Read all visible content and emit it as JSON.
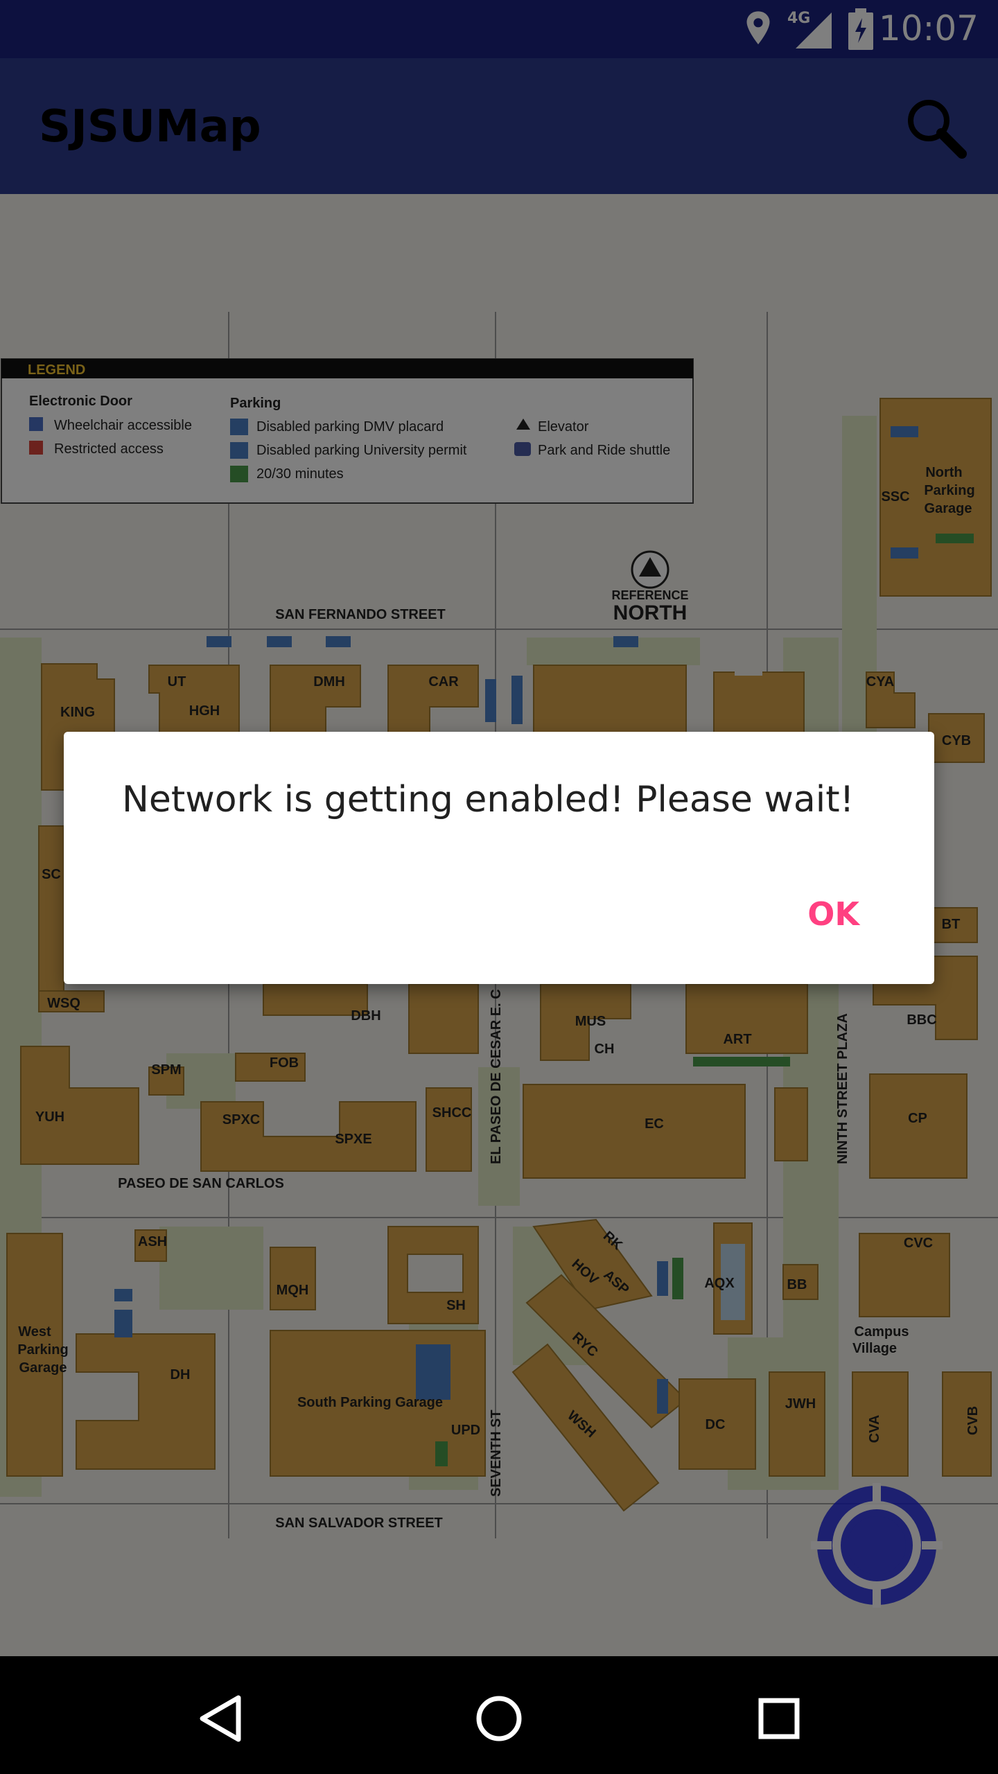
{
  "status_bar": {
    "time": "10:07",
    "network": "4G",
    "icons": [
      "location-icon",
      "signal-icon",
      "battery-icon"
    ]
  },
  "toolbar": {
    "title": "SJSUMap",
    "search_icon": "search-icon"
  },
  "map": {
    "legend": {
      "title": "LEGEND",
      "electronic_door": {
        "heading": "Electronic Door",
        "items": [
          "Wheelchair accessible",
          "Restricted access"
        ]
      },
      "parking": {
        "heading": "Parking",
        "items": [
          "Disabled parking DMV placard",
          "Disabled parking University permit",
          "20/30 minutes"
        ]
      },
      "other": [
        "Elevator",
        "Park and Ride shuttle"
      ]
    },
    "north_label": [
      "REFERENCE",
      "NORTH"
    ],
    "streets": {
      "north": "SAN FERNANDO STREET",
      "south": "SAN SALVADOR STREET",
      "mid": "PASEO DE SAN CARLOS",
      "paseo": "EL PASEO DE CESAR E. C",
      "seventh": "SEVENTH ST",
      "ninth": "NINTH STREET PLAZA"
    },
    "buildings": {
      "king": "KING",
      "ut": "UT",
      "hgh": "HGH",
      "dmh": "DMH",
      "car": "CAR",
      "ssc": "SSC",
      "npg": [
        "North",
        "Parking",
        "Garage"
      ],
      "cya": "CYA",
      "cyb": "CYB",
      "sci": "SC",
      "wsq": "WSQ",
      "dbh": "DBH",
      "mus": "MUS",
      "ch": "CH",
      "art": "ART",
      "bt": "BT",
      "bbc": "BBC",
      "spm": "SPM",
      "fob": "FOB",
      "yuh": "YUH",
      "spxc": "SPXC",
      "spxe": "SPXE",
      "shcc": "SHCC",
      "ec": "EC",
      "cp": "CP",
      "ash": "ASH",
      "mqh": "MQH",
      "sh": "SH",
      "wpg": [
        "West",
        "Parking",
        "Garage"
      ],
      "dh": "DH",
      "spg": "South Parking Garage",
      "upd": "UPD",
      "hov": "HOV",
      "asp": "ASP",
      "ryc": "RYC",
      "wsh": "WSH",
      "aqx": "AQX",
      "bb": "BB",
      "cvc": "CVC",
      "cv": [
        "Campus",
        "Village"
      ],
      "dc": "DC",
      "jwh": "JWH",
      "cva": "CVA",
      "cvb": "CVB",
      "rk": "RK"
    }
  },
  "dialog": {
    "message": "Network is getting enabled! Please wait!",
    "ok_label": "OK"
  },
  "nav_bar": {
    "icons": [
      "back-icon",
      "home-icon",
      "recents-icon"
    ]
  },
  "colors": {
    "status_bar": "#1a237e",
    "toolbar": "#2d3a8c",
    "building": "#d6a34a",
    "accent": "#ff4081",
    "fab": "#0d1170"
  }
}
